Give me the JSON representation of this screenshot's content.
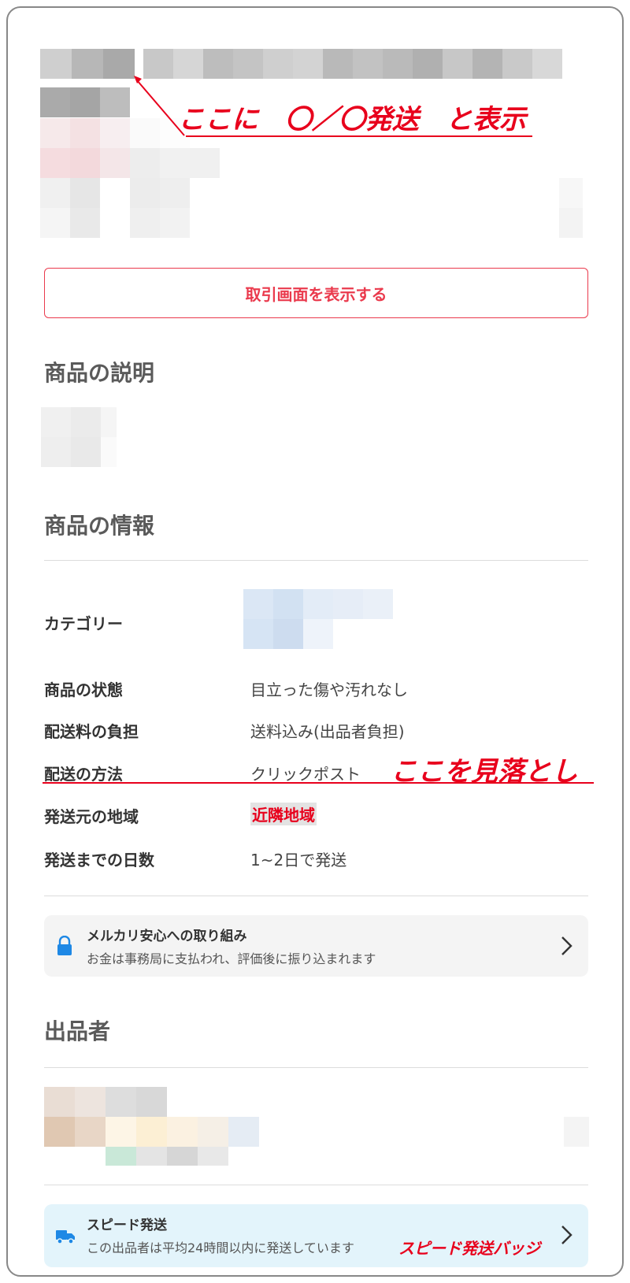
{
  "annotations": {
    "top_note": "ここに　〇／〇発送　と表示",
    "oversight_note": "ここを見落とし",
    "badge_note": "スピード発送バッジ"
  },
  "transaction_button_label": "取引画面を表示する",
  "description_section": {
    "title": "商品の説明"
  },
  "info_section": {
    "title": "商品の情報",
    "rows": [
      {
        "label": "カテゴリー",
        "value": ""
      },
      {
        "label": "商品の状態",
        "value": "目立った傷や汚れなし"
      },
      {
        "label": "配送料の負担",
        "value": "送料込み(出品者負担)"
      },
      {
        "label": "配送の方法",
        "value": "クリックポスト"
      },
      {
        "label": "発送元の地域",
        "value": "近隣地域"
      },
      {
        "label": "発送までの日数",
        "value": "1~2日で発送"
      }
    ]
  },
  "safety_card": {
    "title": "メルカリ安心への取り組み",
    "subtitle": "お金は事務局に支払われ、評価後に振り込まれます",
    "icon": "lock-icon"
  },
  "seller_section": {
    "title": "出品者"
  },
  "speed_card": {
    "title": "スピード発送",
    "subtitle": "この出品者は平均24時間以内に発送しています",
    "icon": "truck-icon"
  },
  "colors": {
    "accent": "#ea3a4d",
    "annotation_red": "#e8001c",
    "blue_icon": "#1e88e5",
    "speed_card_bg": "#e3f4fb",
    "safety_card_bg": "#f4f4f4"
  }
}
